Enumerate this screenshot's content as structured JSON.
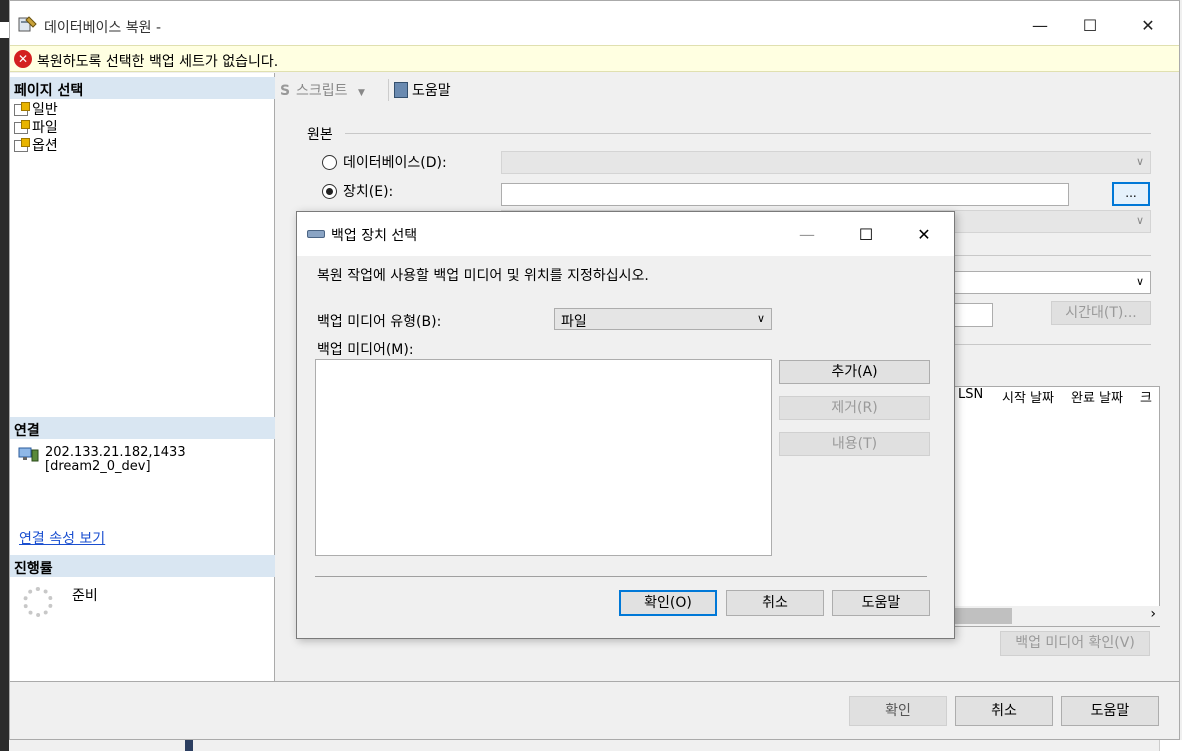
{
  "window": {
    "title": "데이터베이스 복원 -",
    "error_message": "복원하도록 선택한 백업 세트가 없습니다."
  },
  "left_pane": {
    "page_select_header": "페이지 선택",
    "pages": [
      {
        "label": "일반"
      },
      {
        "label": "파일"
      },
      {
        "label": "옵션"
      }
    ],
    "connection_header": "연결",
    "server": "202.133.21.182,1433",
    "database": "[dream2_0_dev]",
    "connection_link": "연결 속성 보기",
    "progress_header": "진행률",
    "progress_status": "준비"
  },
  "toolbar": {
    "script_label": "스크립트",
    "help_label": "도움말"
  },
  "source": {
    "group_label": "원본",
    "database_radio": "데이터베이스(D):",
    "device_radio": "장치(E):",
    "browse_label": "...",
    "timezone_label": "시간대(T)...",
    "columns": [
      "LSN",
      "시작 날짜",
      "완료 날짜",
      "크"
    ],
    "verify_label": "백업 미디어 확인(V)"
  },
  "footer": {
    "ok": "확인",
    "cancel": "취소",
    "help": "도움말"
  },
  "dialog": {
    "title": "백업 장치 선택",
    "instruction": "복원 작업에 사용할 백업 미디어 및 위치를 지정하십시오.",
    "media_type_label": "백업 미디어 유형(B):",
    "media_type_value": "파일",
    "media_label": "백업 미디어(M):",
    "add": "추가(A)",
    "remove": "제거(R)",
    "contents": "내용(T)",
    "ok": "확인(O)",
    "cancel": "취소",
    "help": "도움말"
  }
}
